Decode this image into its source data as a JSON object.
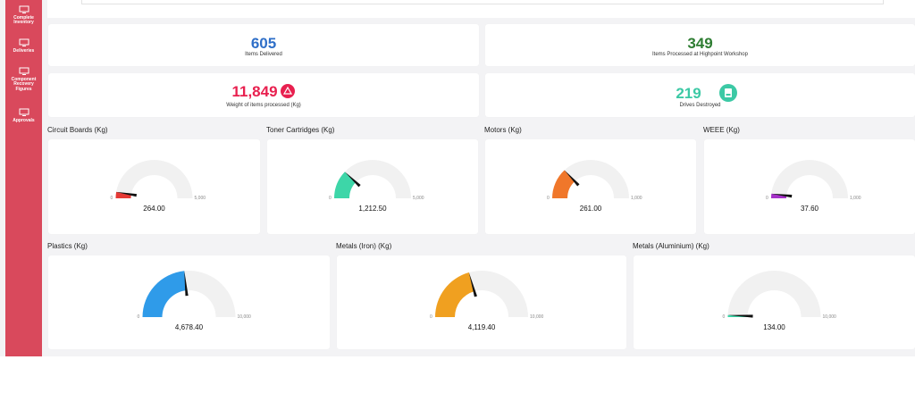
{
  "sidebar": {
    "items": [
      {
        "label_lines": [
          "Complete",
          "Inventory"
        ],
        "icon": "monitor-icon"
      },
      {
        "label_lines": [
          "Deliveries"
        ],
        "icon": "monitor-icon"
      },
      {
        "label_lines": [
          "Component",
          "Recovery",
          "Figures"
        ],
        "icon": "monitor-icon"
      },
      {
        "label_lines": [
          "Approvals"
        ],
        "icon": "monitor-icon"
      }
    ],
    "color": "#d9495c"
  },
  "stats": {
    "delivered": {
      "value": "605",
      "label": "Items Delivered",
      "color": "#2f6fc8"
    },
    "processed": {
      "value": "349",
      "label": "Items Processed at Highpoint Workshop",
      "color": "#2e7d32"
    },
    "weight": {
      "value": "11,849",
      "label": "Weight of items processed (Kg)",
      "color": "#e8204f",
      "icon": "warning-triangle-icon"
    },
    "drives": {
      "value": "219",
      "label": "Drives Destroyed",
      "color": "#3cc9a5",
      "icon": "drive-icon"
    }
  },
  "gauges": [
    {
      "title": "Circuit Boards (Kg)",
      "value": 264.0,
      "value_text": "264.00",
      "min": "0",
      "max": "5,000",
      "max_value": 5000,
      "color": "#e53935"
    },
    {
      "title": "Toner Cartridges (Kg)",
      "value": 1212.5,
      "value_text": "1,212.50",
      "min": "0",
      "max": "5,000",
      "max_value": 5000,
      "color": "#3dd6a8"
    },
    {
      "title": "Motors (Kg)",
      "value": 261.0,
      "value_text": "261.00",
      "min": "0",
      "max": "1,000",
      "max_value": 1000,
      "color": "#f0772a"
    },
    {
      "title": "WEEE (Kg)",
      "value": 37.6,
      "value_text": "37.60",
      "min": "0",
      "max": "1,000",
      "max_value": 1000,
      "color": "#a632c9"
    },
    {
      "title": "Plastics (Kg)",
      "value": 4678.4,
      "value_text": "4,678.40",
      "min": "0",
      "max": "10,000",
      "max_value": 10000,
      "color": "#2f9be9"
    },
    {
      "title": "Metals (Iron) (Kg)",
      "value": 4119.4,
      "value_text": "4,119.40",
      "min": "0",
      "max": "10,000",
      "max_value": 10000,
      "color": "#f0a020"
    },
    {
      "title": "Metals (Aluminium) (Kg)",
      "value": 134.0,
      "value_text": "134.00",
      "min": "0",
      "max": "10,000",
      "max_value": 10000,
      "color": "#3dd6a8"
    }
  ]
}
